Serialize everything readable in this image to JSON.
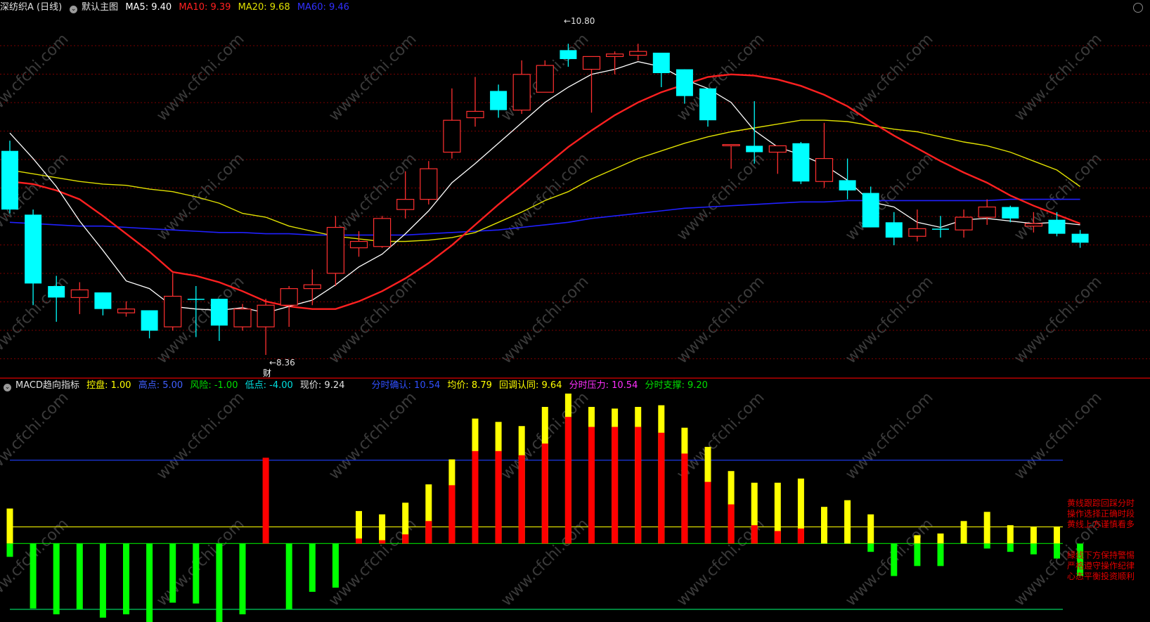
{
  "main_header": {
    "stock": "深纺织A (日线)",
    "panel": "默认主图",
    "ma5": "MA5: 9.40",
    "ma10": "MA10: 9.39",
    "ma20": "MA20: 9.68",
    "ma60": "MA60: 9.46"
  },
  "sub_header": {
    "name": "MACD趋向指标",
    "kongpan": "控盘: 1.00",
    "gaodian": "高点: 5.00",
    "fengxian": "风险: -1.00",
    "didian": "低点: -4.00",
    "xianjia": "现价: 9.24",
    "fenshi_queren": "分时确认: 10.54",
    "junjia": "均价: 8.79",
    "huitiao": "回调认同: 9.64",
    "fenshi_yali": "分时压力: 10.54",
    "fenshi_zhicheng": "分时支撑: 9.20"
  },
  "annotations": {
    "high": "10.80",
    "low": "8.36",
    "cai": "财",
    "note_top": [
      "黄线跟踪回踩分时",
      "操作选择正确时段",
      "黄线上方谨慎看多"
    ],
    "note_bot": [
      "绿线下方保持警惕",
      "严格遵守操作纪律",
      "心态平衡投资顺利"
    ],
    "watermark": "www.cfchi.com"
  },
  "colors": {
    "up": "#ff3030",
    "down": "#00ffff",
    "ma5": "#ffffff",
    "ma10": "#ff2020",
    "ma20": "#e0e000",
    "ma60": "#2020ff",
    "grid": "#7a0000",
    "hist_red": "#ff0000",
    "hist_yellow": "#ffff00",
    "hist_green": "#00ff00",
    "ref_blue": "#2040ff",
    "ref_yellow": "#d8d800",
    "ref_green": "#00e000",
    "ref_green2": "#00d060"
  },
  "chart_data": [
    {
      "type": "candlestick",
      "price_range": [
        8.2,
        11.0
      ],
      "highlight": {
        "high": 10.8,
        "high_index": 24,
        "low": 8.36,
        "low_index": 11
      },
      "candles": [
        {
          "o": 9.96,
          "h": 10.04,
          "l": 9.47,
          "c": 9.5
        },
        {
          "o": 9.46,
          "h": 9.5,
          "l": 8.75,
          "c": 8.92
        },
        {
          "o": 8.9,
          "h": 8.98,
          "l": 8.62,
          "c": 8.81
        },
        {
          "o": 8.81,
          "h": 8.93,
          "l": 8.68,
          "c": 8.87
        },
        {
          "o": 8.85,
          "h": 8.85,
          "l": 8.67,
          "c": 8.72
        },
        {
          "o": 8.69,
          "h": 8.78,
          "l": 8.66,
          "c": 8.72
        },
        {
          "o": 8.71,
          "h": 8.71,
          "l": 8.49,
          "c": 8.55
        },
        {
          "o": 8.58,
          "h": 9.0,
          "l": 8.55,
          "c": 8.82
        },
        {
          "o": 8.8,
          "h": 8.9,
          "l": 8.5,
          "c": 8.8
        },
        {
          "o": 8.8,
          "h": 8.8,
          "l": 8.47,
          "c": 8.59
        },
        {
          "o": 8.58,
          "h": 8.76,
          "l": 8.55,
          "c": 8.72
        },
        {
          "o": 8.58,
          "h": 8.8,
          "l": 8.36,
          "c": 8.75
        },
        {
          "o": 8.75,
          "h": 8.9,
          "l": 8.58,
          "c": 8.88
        },
        {
          "o": 8.88,
          "h": 9.03,
          "l": 8.75,
          "c": 8.91
        },
        {
          "o": 9.0,
          "h": 9.45,
          "l": 8.9,
          "c": 9.36
        },
        {
          "o": 9.2,
          "h": 9.33,
          "l": 9.13,
          "c": 9.25
        },
        {
          "o": 9.21,
          "h": 9.45,
          "l": 9.2,
          "c": 9.43
        },
        {
          "o": 9.5,
          "h": 9.8,
          "l": 9.43,
          "c": 9.58
        },
        {
          "o": 9.58,
          "h": 9.88,
          "l": 9.54,
          "c": 9.82
        },
        {
          "o": 9.95,
          "h": 10.45,
          "l": 9.9,
          "c": 10.2
        },
        {
          "o": 10.22,
          "h": 10.54,
          "l": 10.15,
          "c": 10.27
        },
        {
          "o": 10.43,
          "h": 10.48,
          "l": 10.22,
          "c": 10.28
        },
        {
          "o": 10.28,
          "h": 10.67,
          "l": 10.25,
          "c": 10.56
        },
        {
          "o": 10.42,
          "h": 10.67,
          "l": 10.55,
          "c": 10.63
        },
        {
          "o": 10.75,
          "h": 10.8,
          "l": 10.62,
          "c": 10.68
        },
        {
          "o": 10.6,
          "h": 10.65,
          "l": 10.26,
          "c": 10.7
        },
        {
          "o": 10.7,
          "h": 10.74,
          "l": 10.56,
          "c": 10.72
        },
        {
          "o": 10.71,
          "h": 10.8,
          "l": 10.67,
          "c": 10.74
        },
        {
          "o": 10.73,
          "h": 10.73,
          "l": 10.46,
          "c": 10.57
        },
        {
          "o": 10.6,
          "h": 10.6,
          "l": 10.33,
          "c": 10.39
        },
        {
          "o": 10.45,
          "h": 10.45,
          "l": 10.15,
          "c": 10.2
        },
        {
          "o": 10.0,
          "h": 10.0,
          "l": 9.82,
          "c": 10.01
        },
        {
          "o": 10.0,
          "h": 10.35,
          "l": 9.86,
          "c": 9.95
        },
        {
          "o": 9.95,
          "h": 9.92,
          "l": 9.78,
          "c": 10.0
        },
        {
          "o": 10.02,
          "h": 10.03,
          "l": 9.7,
          "c": 9.72
        },
        {
          "o": 9.72,
          "h": 10.18,
          "l": 9.67,
          "c": 9.9
        },
        {
          "o": 9.73,
          "h": 9.9,
          "l": 9.58,
          "c": 9.65
        },
        {
          "o": 9.63,
          "h": 9.68,
          "l": 9.41,
          "c": 9.36
        },
        {
          "o": 9.4,
          "h": 9.48,
          "l": 9.22,
          "c": 9.28
        },
        {
          "o": 9.29,
          "h": 9.5,
          "l": 9.25,
          "c": 9.35
        },
        {
          "o": 9.35,
          "h": 9.45,
          "l": 9.28,
          "c": 9.35
        },
        {
          "o": 9.34,
          "h": 9.5,
          "l": 9.28,
          "c": 9.44
        },
        {
          "o": 9.44,
          "h": 9.58,
          "l": 9.38,
          "c": 9.52
        },
        {
          "o": 9.52,
          "h": 9.53,
          "l": 9.4,
          "c": 9.43
        },
        {
          "o": 9.37,
          "h": 9.48,
          "l": 9.32,
          "c": 9.39
        },
        {
          "o": 9.42,
          "h": 9.48,
          "l": 9.29,
          "c": 9.31
        },
        {
          "o": 9.31,
          "h": 9.34,
          "l": 9.2,
          "c": 9.24
        }
      ],
      "ma5": [
        10.1,
        9.9,
        9.68,
        9.41,
        9.18,
        8.94,
        8.88,
        8.74,
        8.72,
        8.71,
        8.73,
        8.69,
        8.74,
        8.79,
        8.91,
        9.05,
        9.15,
        9.31,
        9.49,
        9.71,
        9.86,
        10.02,
        10.18,
        10.34,
        10.46,
        10.56,
        10.6,
        10.66,
        10.62,
        10.52,
        10.45,
        10.34,
        10.12,
        9.99,
        9.93,
        9.85,
        9.73,
        9.56,
        9.52,
        9.4,
        9.36,
        9.42,
        9.43,
        9.41,
        9.39,
        9.4,
        9.38
      ],
      "ma10": [
        9.72,
        9.7,
        9.65,
        9.58,
        9.45,
        9.31,
        9.17,
        9.01,
        8.98,
        8.93,
        8.86,
        8.78,
        8.74,
        8.72,
        8.72,
        8.78,
        8.86,
        8.96,
        9.08,
        9.22,
        9.38,
        9.54,
        9.69,
        9.84,
        9.99,
        10.12,
        10.24,
        10.34,
        10.42,
        10.48,
        10.54,
        10.56,
        10.55,
        10.52,
        10.47,
        10.4,
        10.31,
        10.19,
        10.08,
        9.98,
        9.88,
        9.79,
        9.71,
        9.61,
        9.53,
        9.46,
        9.39
      ],
      "ma20": [
        9.81,
        9.78,
        9.75,
        9.72,
        9.7,
        9.69,
        9.66,
        9.64,
        9.6,
        9.55,
        9.47,
        9.44,
        9.37,
        9.33,
        9.29,
        9.27,
        9.25,
        9.25,
        9.26,
        9.28,
        9.32,
        9.4,
        9.48,
        9.57,
        9.64,
        9.74,
        9.82,
        9.9,
        9.96,
        10.02,
        10.07,
        10.11,
        10.14,
        10.17,
        10.2,
        10.2,
        10.19,
        10.16,
        10.13,
        10.11,
        10.07,
        10.03,
        10.0,
        9.95,
        9.88,
        9.81,
        9.68
      ],
      "ma60": [
        9.4,
        9.39,
        9.38,
        9.37,
        9.37,
        9.36,
        9.35,
        9.34,
        9.33,
        9.32,
        9.32,
        9.31,
        9.31,
        9.3,
        9.3,
        9.3,
        9.3,
        9.3,
        9.31,
        9.32,
        9.33,
        9.34,
        9.36,
        9.38,
        9.4,
        9.43,
        9.45,
        9.47,
        9.49,
        9.51,
        9.52,
        9.53,
        9.54,
        9.55,
        9.56,
        9.56,
        9.57,
        9.57,
        9.57,
        9.57,
        9.57,
        9.57,
        9.57,
        9.58,
        9.58,
        9.58,
        9.58
      ]
    },
    {
      "type": "bar",
      "name": "MACD趋向指标",
      "value_range": [
        -4.5,
        9.0
      ],
      "reference_lines": {
        "gaodian": 5.0,
        "kongpan": 1.0,
        "fengxian": -1.0,
        "didian": -4.0
      },
      "bars": [
        {
          "red": 0,
          "yellow": 2.1,
          "green": -0.8
        },
        {
          "red": 0,
          "yellow": 0,
          "green": -3.9
        },
        {
          "red": 0,
          "yellow": 0,
          "green": -4.25
        },
        {
          "red": 0,
          "yellow": 0,
          "green": -3.95
        },
        {
          "red": 0,
          "yellow": 0,
          "green": -4.45
        },
        {
          "red": 0,
          "yellow": 0,
          "green": -4.25
        },
        {
          "red": 0,
          "yellow": 0,
          "green": -4.95
        },
        {
          "red": 0,
          "yellow": 0,
          "green": -3.55
        },
        {
          "red": 0,
          "yellow": 0,
          "green": -3.6
        },
        {
          "red": 0,
          "yellow": 0,
          "green": -4.85
        },
        {
          "red": 0,
          "yellow": 0,
          "green": -4.25
        },
        {
          "red": 5.15,
          "yellow": 0,
          "green": 0
        },
        {
          "red": 0,
          "yellow": 0,
          "green": -3.95
        },
        {
          "red": 0,
          "yellow": 0,
          "green": -2.9
        },
        {
          "red": 0,
          "yellow": 0,
          "green": -2.65
        },
        {
          "red": 0.3,
          "yellow": 1.95,
          "green": 0
        },
        {
          "red": 0.2,
          "yellow": 1.75,
          "green": 0
        },
        {
          "red": 0.55,
          "yellow": 2.45,
          "green": 0
        },
        {
          "red": 1.35,
          "yellow": 3.55,
          "green": 0
        },
        {
          "red": 3.5,
          "yellow": 5.05,
          "green": 0
        },
        {
          "red": 5.55,
          "yellow": 7.5,
          "green": 0
        },
        {
          "red": 5.55,
          "yellow": 7.3,
          "green": 0
        },
        {
          "red": 5.3,
          "yellow": 7.05,
          "green": 0
        },
        {
          "red": 6.0,
          "yellow": 8.2,
          "green": 0
        },
        {
          "red": 7.6,
          "yellow": 9.0,
          "green": 0
        },
        {
          "red": 7.0,
          "yellow": 8.2,
          "green": 0
        },
        {
          "red": 7.0,
          "yellow": 8.1,
          "green": 0
        },
        {
          "red": 7.0,
          "yellow": 8.2,
          "green": 0
        },
        {
          "red": 6.65,
          "yellow": 8.3,
          "green": 0
        },
        {
          "red": 5.4,
          "yellow": 6.95,
          "green": 0
        },
        {
          "red": 3.7,
          "yellow": 5.8,
          "green": 0
        },
        {
          "red": 2.35,
          "yellow": 4.35,
          "green": 0
        },
        {
          "red": 1.1,
          "yellow": 3.65,
          "green": 0
        },
        {
          "red": 0.75,
          "yellow": 3.65,
          "green": 0
        },
        {
          "red": 0.9,
          "yellow": 3.9,
          "green": 0
        },
        {
          "red": 0,
          "yellow": 2.2,
          "green": 0
        },
        {
          "red": 0,
          "yellow": 2.6,
          "green": 0
        },
        {
          "red": 0,
          "yellow": 1.75,
          "green": -0.5
        },
        {
          "red": 0,
          "yellow": 0,
          "green": -1.95
        },
        {
          "red": 0,
          "yellow": 0.5,
          "green": -1.35
        },
        {
          "red": 0,
          "yellow": 0.6,
          "green": -1.35
        },
        {
          "red": 0,
          "yellow": 1.35,
          "green": 0
        },
        {
          "red": 0,
          "yellow": 1.9,
          "green": -0.3
        },
        {
          "red": 0,
          "yellow": 1.1,
          "green": -0.5
        },
        {
          "red": 0,
          "yellow": 1.0,
          "green": -0.65
        },
        {
          "red": 0,
          "yellow": 1.0,
          "green": -0.9
        },
        {
          "red": 0,
          "yellow": 0,
          "green": -1.95
        }
      ]
    }
  ]
}
